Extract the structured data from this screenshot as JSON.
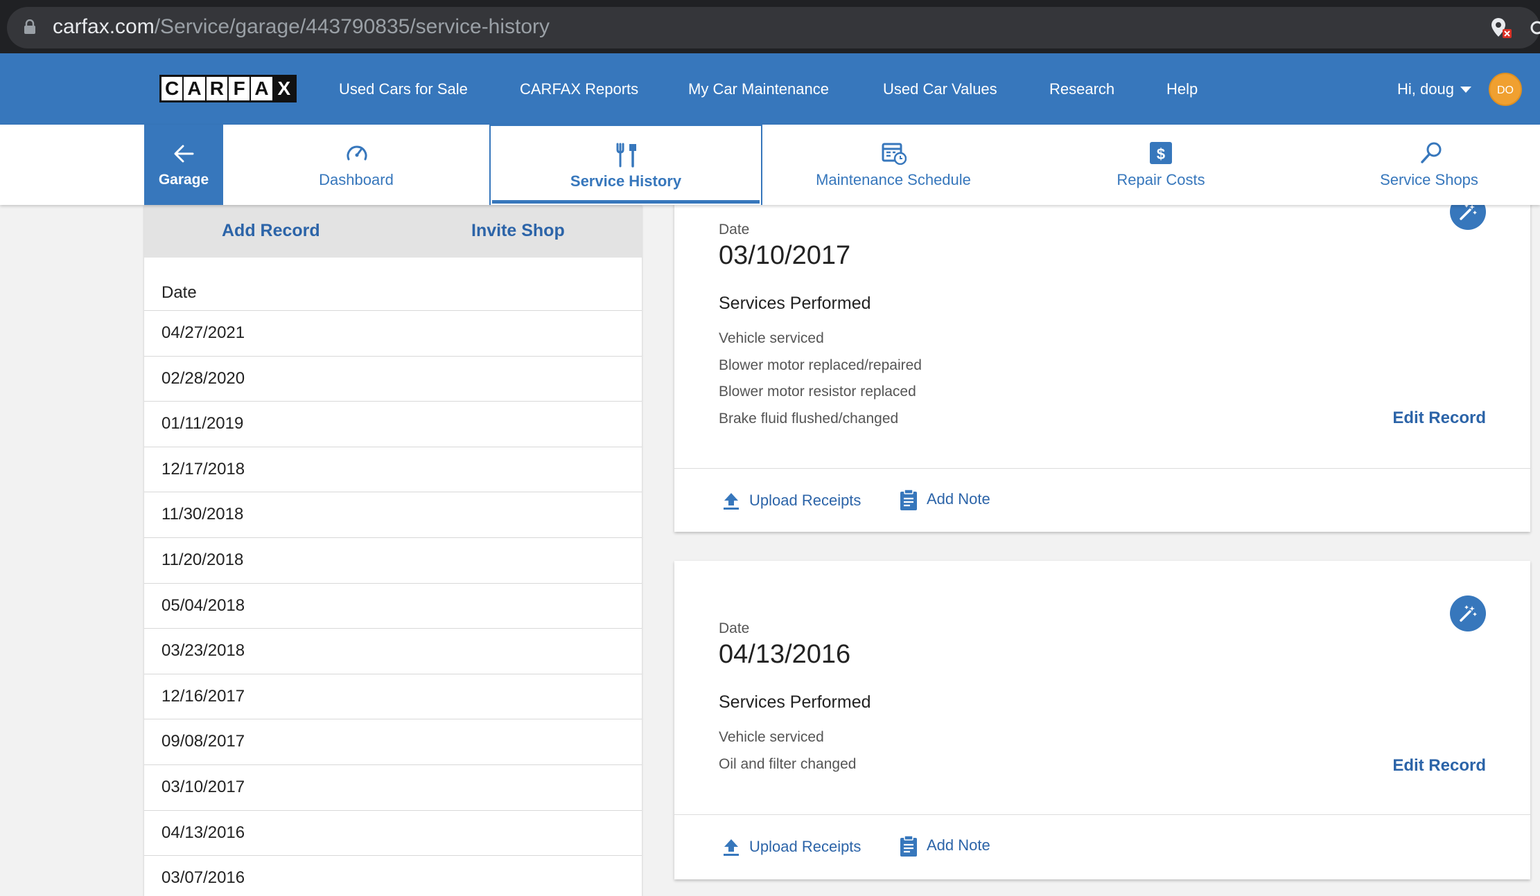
{
  "browser": {
    "url_domain": "carfax.com",
    "url_path": "/Service/garage/443790835/service-history"
  },
  "brand": {
    "logo_letters": [
      "C",
      "A",
      "R",
      "F",
      "A",
      "X"
    ],
    "accent": "#3777bc",
    "link": "#2c64a8",
    "avatar_bg": "#f0a030"
  },
  "topnav": {
    "links": [
      "Used Cars for Sale",
      "CARFAX Reports",
      "My Car Maintenance",
      "Used Car Values",
      "Research",
      "Help"
    ],
    "user_greeting": "Hi, doug",
    "avatar_initials": "DO"
  },
  "subnav": {
    "back_label": "Garage",
    "tabs": [
      {
        "label": "Dashboard",
        "icon": "speedometer-icon"
      },
      {
        "label": "Service History",
        "icon": "tools-icon",
        "active": true
      },
      {
        "label": "Maintenance Schedule",
        "icon": "calendar-clock-icon"
      },
      {
        "label": "Repair Costs",
        "icon": "dollar-icon"
      },
      {
        "label": "Service Shops",
        "icon": "search-icon"
      }
    ]
  },
  "sidebar": {
    "add_record": "Add Record",
    "invite_shop": "Invite Shop",
    "header": "Date",
    "dates": [
      "04/27/2021",
      "02/28/2020",
      "01/11/2019",
      "12/17/2018",
      "11/30/2018",
      "11/20/2018",
      "05/04/2018",
      "03/23/2018",
      "12/16/2017",
      "09/08/2017",
      "03/10/2017",
      "04/13/2016",
      "03/07/2016"
    ]
  },
  "records": [
    {
      "date_label": "Date",
      "date": "03/10/2017",
      "services_title": "Services Performed",
      "services": [
        "Vehicle serviced",
        "Blower motor replaced/repaired",
        "Blower motor resistor replaced",
        "Brake fluid flushed/changed"
      ],
      "edit_label": "Edit Record",
      "upload_label": "Upload Receipts",
      "note_label": "Add Note"
    },
    {
      "date_label": "Date",
      "date": "04/13/2016",
      "services_title": "Services Performed",
      "services": [
        "Vehicle serviced",
        "Oil and filter changed"
      ],
      "edit_label": "Edit Record",
      "upload_label": "Upload Receipts",
      "note_label": "Add Note"
    }
  ]
}
